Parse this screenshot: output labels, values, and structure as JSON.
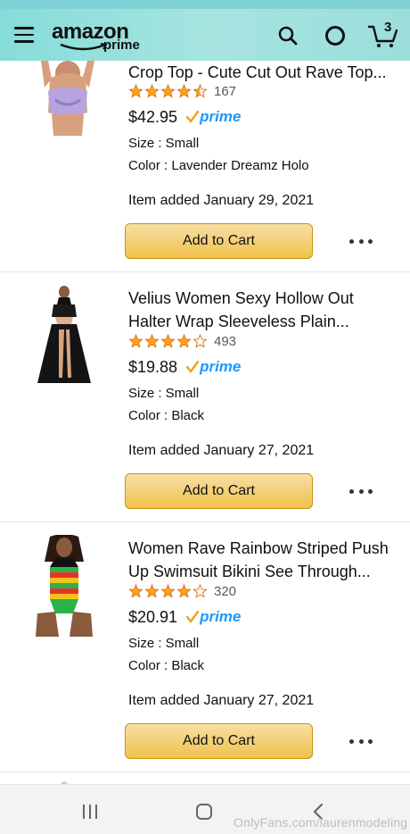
{
  "header": {
    "logo_word": "amazon",
    "logo_sub": "prime",
    "cart_count": "3"
  },
  "items": [
    {
      "title_line1": "Crop Top - Cute Cut Out Rave Top...",
      "title_line2": "",
      "rating": 4.5,
      "review_count": "167",
      "price": "$42.95",
      "prime_label": "prime",
      "size": "Size : Small",
      "color": "Color : Lavender Dreamz Holo",
      "added": "Item added January 29, 2021",
      "cart_label": "Add to Cart"
    },
    {
      "title_line1": "Velius Women Sexy Hollow Out",
      "title_line2": "Halter Wrap Sleeveless Plain...",
      "rating": 4.0,
      "review_count": "493",
      "price": "$19.88",
      "prime_label": "prime",
      "size": "Size : Small",
      "color": "Color : Black",
      "added": "Item added January 27, 2021",
      "cart_label": "Add to Cart"
    },
    {
      "title_line1": "Women Rave Rainbow Striped Push",
      "title_line2": "Up Swimsuit Bikini See Through...",
      "rating": 4.0,
      "review_count": "320",
      "price": "$20.91",
      "prime_label": "prime",
      "size": "Size : Small",
      "color": "Color : Black",
      "added": "Item added January 27, 2021",
      "cart_label": "Add to Cart"
    }
  ],
  "watermark": "OnlyFans.com/laurenmodeling",
  "colors": {
    "header_bg": "#a6e4e0",
    "button_bg": "#f0c14b",
    "prime_blue": "#1a98ff",
    "star_orange": "#ffa41c"
  }
}
